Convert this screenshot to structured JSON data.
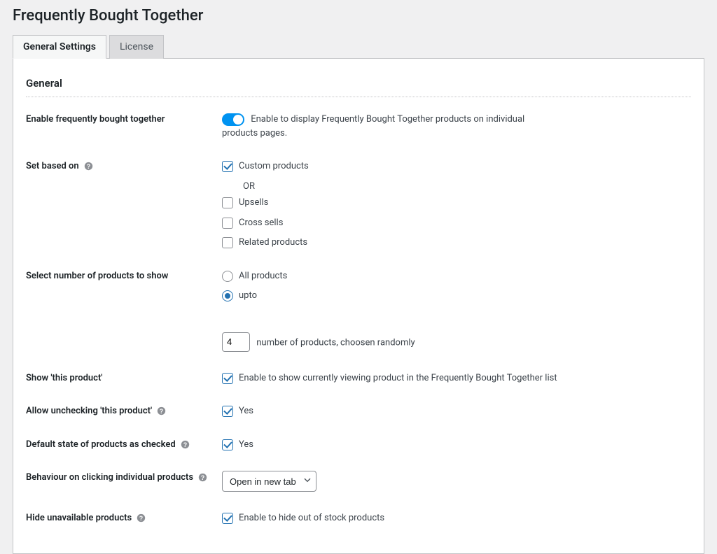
{
  "page": {
    "title": "Frequently Bought Together"
  },
  "tabs": {
    "general": "General Settings",
    "license": "License"
  },
  "section": {
    "general": "General"
  },
  "labels": {
    "enable": "Enable frequently bought together",
    "set_based_on": "Set based on",
    "select_number": "Select number of products to show",
    "show_this_product": "Show 'this product'",
    "allow_uncheck": "Allow unchecking 'this product'",
    "default_checked": "Default state of products as checked",
    "behaviour_click": "Behaviour on clicking individual products",
    "hide_unavailable": "Hide unavailable products"
  },
  "controls": {
    "enable_desc": "Enable to display Frequently Bought Together products on individual products pages.",
    "custom_products": "Custom products",
    "or": "OR",
    "upsells": "Upsells",
    "cross_sells": "Cross sells",
    "related": "Related products",
    "all_products": "All products",
    "upto": "upto",
    "num_value": "4",
    "num_suffix": "number of products, choosen randomly",
    "show_this_desc": "Enable to show currently viewing product in the Frequently Bought Together list",
    "yes1": "Yes",
    "yes2": "Yes",
    "open_new_tab": "Open in new tab",
    "hide_desc": "Enable to hide out of stock products"
  },
  "state": {
    "enable_toggle": true,
    "cb_custom": true,
    "cb_upsells": false,
    "cb_cross": false,
    "cb_related": false,
    "radio_all": false,
    "radio_upto": true,
    "cb_show_this": true,
    "cb_allow_uncheck": true,
    "cb_default_checked": true,
    "cb_hide_unavailable": true
  }
}
